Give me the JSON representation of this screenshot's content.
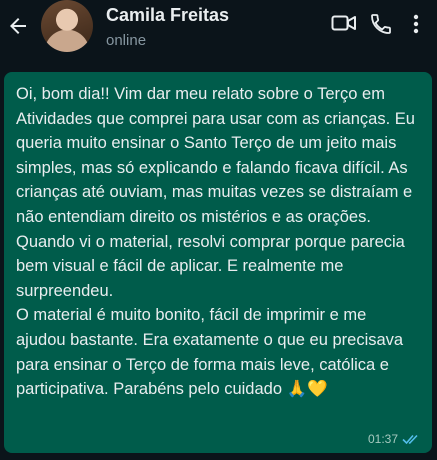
{
  "header": {
    "contact_name": "Camila Freitas",
    "status": "online",
    "icons": [
      "back-arrow-icon",
      "video-call-icon",
      "phone-call-icon",
      "more-options-icon"
    ]
  },
  "message": {
    "text": "Oi, bom dia!! Vim dar meu relato sobre o Terço em Atividades que comprei para usar com as crianças. Eu queria muito ensinar o Santo Terço de um jeito mais simples, mas só explicando e falando ficava difícil. As crianças até ouviam, mas muitas vezes se distraíam e não entendiam direito os mistérios e as orações.\nQuando vi o material, resolvi comprar porque parecia bem visual e fácil de aplicar. E realmente me surpreendeu.\nO material é muito bonito, fácil de imprimir e me ajudou bastante. Era exatamente o que eu precisava para ensinar o Terço de forma mais leve, católica e participativa. Parabéns pelo cuidado 🙏💛",
    "time": "01:37",
    "status_icon": "double-check-read-icon"
  },
  "colors": {
    "background": "#0b141a",
    "bubble": "#005c4b",
    "text": "#e9edef",
    "read_ticks": "#53bdeb"
  }
}
